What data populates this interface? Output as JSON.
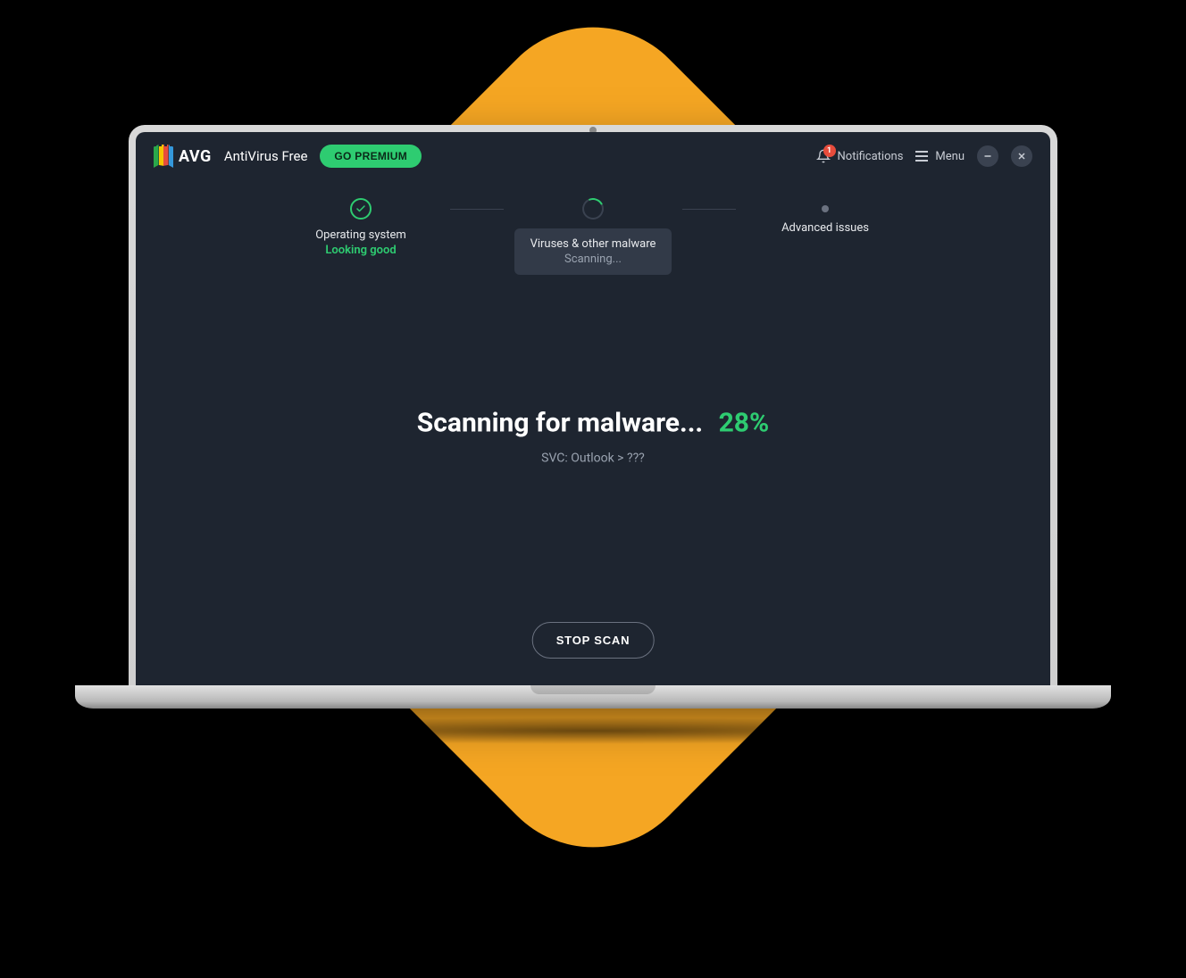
{
  "header": {
    "brand": "AVG",
    "product": "AntiVirus Free",
    "premium_button": "GO PREMIUM",
    "notifications_label": "Notifications",
    "notification_count": "1",
    "menu_label": "Menu"
  },
  "steps": [
    {
      "title": "Operating system",
      "status": "Looking good",
      "state": "done"
    },
    {
      "title": "Viruses & other malware",
      "status": "Scanning...",
      "state": "active"
    },
    {
      "title": "Advanced issues",
      "status": "",
      "state": "pending"
    }
  ],
  "scan": {
    "title": "Scanning for malware...",
    "percent": "28%",
    "path": "SVC: Outlook > ???"
  },
  "actions": {
    "stop": "STOP SCAN"
  },
  "colors": {
    "accent": "#2ecc71",
    "bg": "#1e2530",
    "diamond": "#f5a623"
  }
}
